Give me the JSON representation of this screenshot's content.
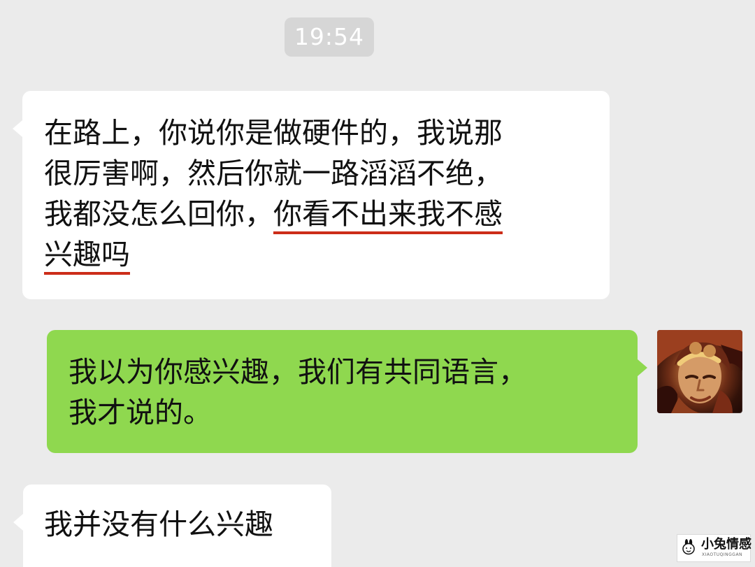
{
  "timestamp": "19:54",
  "messages": [
    {
      "side": "left",
      "bubble_color": "#ffffff",
      "lines": [
        {
          "segments": [
            {
              "text": "在路上，你说你是做硬件的，我说那",
              "underline": false
            }
          ]
        },
        {
          "segments": [
            {
              "text": "很厉害啊，然后你就一路滔滔不绝，",
              "underline": false
            }
          ]
        },
        {
          "segments": [
            {
              "text": "我都没怎么回你，",
              "underline": false
            },
            {
              "text": "你看不出来我不感",
              "underline": true
            }
          ]
        },
        {
          "segments": [
            {
              "text": "兴趣吗",
              "underline": true
            }
          ]
        }
      ]
    },
    {
      "side": "right",
      "bubble_color": "#8fd84f",
      "lines": [
        {
          "segments": [
            {
              "text": "我以为你感兴趣，我们有共同语言，",
              "underline": false
            }
          ]
        },
        {
          "segments": [
            {
              "text": "我才说的。",
              "underline": false
            }
          ]
        }
      ]
    },
    {
      "side": "left",
      "bubble_color": "#ffffff",
      "lines": [
        {
          "segments": [
            {
              "text": "我并没有什么兴趣",
              "underline": false
            }
          ]
        }
      ]
    }
  ],
  "avatar_icon": "avatar",
  "watermark": {
    "title": "小兔情感",
    "subtitle": "XIAOTUQINGGAN",
    "icon": "rabbit-logo-icon"
  },
  "colors": {
    "background": "#ebebeb",
    "timestamp_bg": "#d6d6d6",
    "incoming_bubble": "#ffffff",
    "outgoing_bubble": "#8fd84f",
    "underline": "#cc2d19"
  }
}
